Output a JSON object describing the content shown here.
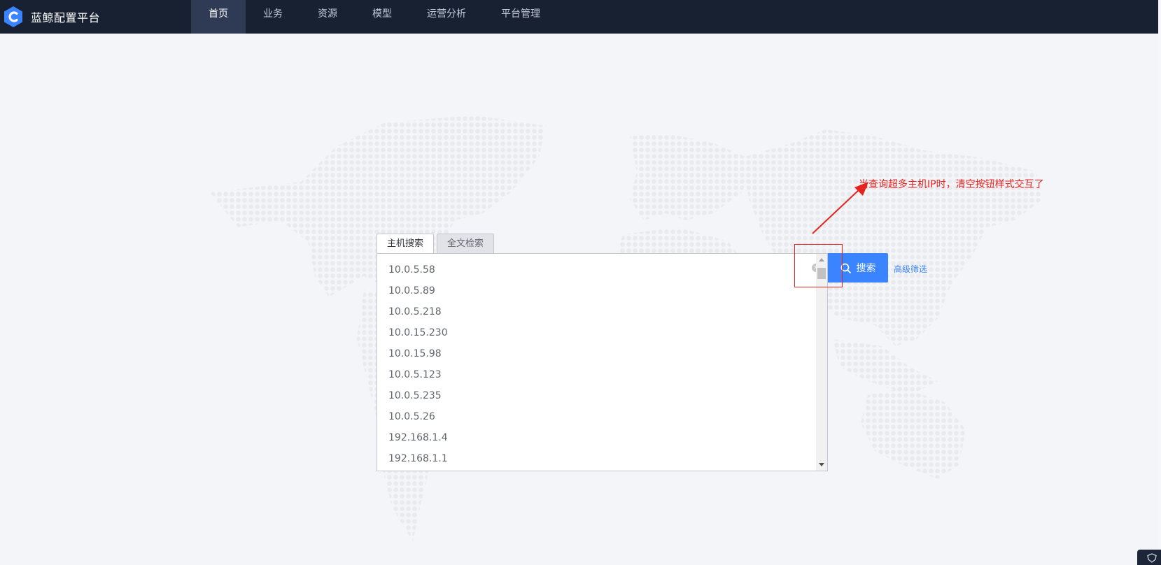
{
  "app": {
    "title": "蓝鲸配置平台",
    "brand_color": "#3a84ff",
    "nav_bg": "#182132"
  },
  "nav": {
    "items": [
      {
        "label": "首页",
        "active": true
      },
      {
        "label": "业务",
        "active": false
      },
      {
        "label": "资源",
        "active": false
      },
      {
        "label": "模型",
        "active": false
      },
      {
        "label": "运营分析",
        "active": false
      },
      {
        "label": "平台管理",
        "active": false
      }
    ]
  },
  "search": {
    "tabs": [
      {
        "label": "主机搜索",
        "active": true
      },
      {
        "label": "全文检索",
        "active": false
      }
    ],
    "ips": [
      "10.0.5.58",
      "10.0.5.89",
      "10.0.5.218",
      "10.0.15.230",
      "10.0.15.98",
      "10.0.5.123",
      "10.0.5.235",
      "10.0.5.26",
      "192.168.1.4",
      "192.168.1.1"
    ],
    "search_button_label": "搜索",
    "advanced_label": "高级筛选"
  },
  "annotation": {
    "text": "当查询超多主机IP时，清空按钮样式交互了",
    "color": "#e52420"
  },
  "icons": {
    "logo": "bluewhale-logo-icon",
    "search": "search-icon",
    "clear": "clear-icon",
    "corner": "shield-icon"
  }
}
